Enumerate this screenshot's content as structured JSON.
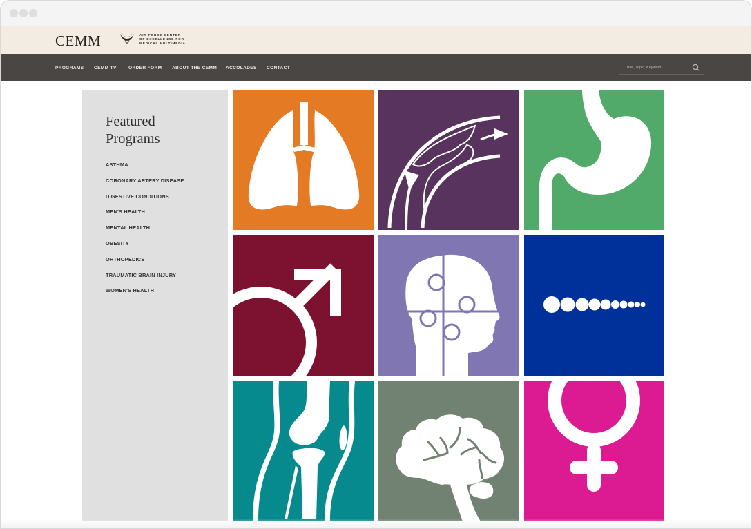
{
  "window": {
    "controls": [
      "close",
      "minimize",
      "maximize"
    ]
  },
  "brand": {
    "logo_text": "CEMM",
    "tagline": [
      "AIR FORCE CENTER",
      "OF EXCELLENCE FOR",
      "MEDICAL MULTIMEDIA"
    ],
    "logo_icon": "air-force-eagle-icon"
  },
  "nav": {
    "items": [
      {
        "label": "PROGRAMS"
      },
      {
        "label": "CEMM TV"
      },
      {
        "label": "ORDER FORM"
      },
      {
        "label": "ABOUT THE CEMM"
      },
      {
        "label": "ACCOLADES"
      },
      {
        "label": "CONTACT"
      }
    ],
    "search": {
      "placeholder": "Title, Topic, Keyword",
      "value": "",
      "icon": "search-icon"
    }
  },
  "sidebar": {
    "title_line1": "Featured",
    "title_line2": "Programs",
    "items": [
      {
        "label": "ASTHMA"
      },
      {
        "label": "CORONARY ARTERY DISEASE"
      },
      {
        "label": "DIGESTIVE CONDITIONS"
      },
      {
        "label": "MEN'S HEALTH"
      },
      {
        "label": "MENTAL HEALTH"
      },
      {
        "label": "OBESITY"
      },
      {
        "label": "ORTHOPEDICS"
      },
      {
        "label": "TRAUMATIC BRAIN INJURY"
      },
      {
        "label": "WOMEN'S HEALTH"
      }
    ]
  },
  "tiles": [
    {
      "program": "Asthma",
      "icon": "lungs-icon",
      "color": "#e47a24"
    },
    {
      "program": "Coronary Artery Disease",
      "icon": "artery-plaque-icon",
      "color": "#57335e"
    },
    {
      "program": "Digestive Conditions",
      "icon": "stomach-icon",
      "color": "#51a96a"
    },
    {
      "program": "Men's Health",
      "icon": "male-symbol-icon",
      "color": "#7c1230"
    },
    {
      "program": "Mental Health",
      "icon": "puzzle-head-icon",
      "color": "#7f76b2"
    },
    {
      "program": "Obesity",
      "icon": "circles-row-icon",
      "color": "#00309a"
    },
    {
      "program": "Orthopedics",
      "icon": "knee-joint-icon",
      "color": "#068a8e"
    },
    {
      "program": "Traumatic Brain Injury",
      "icon": "brain-icon",
      "color": "#728272"
    },
    {
      "program": "Women's Health",
      "icon": "female-symbol-icon",
      "color": "#dc1b93"
    }
  ]
}
